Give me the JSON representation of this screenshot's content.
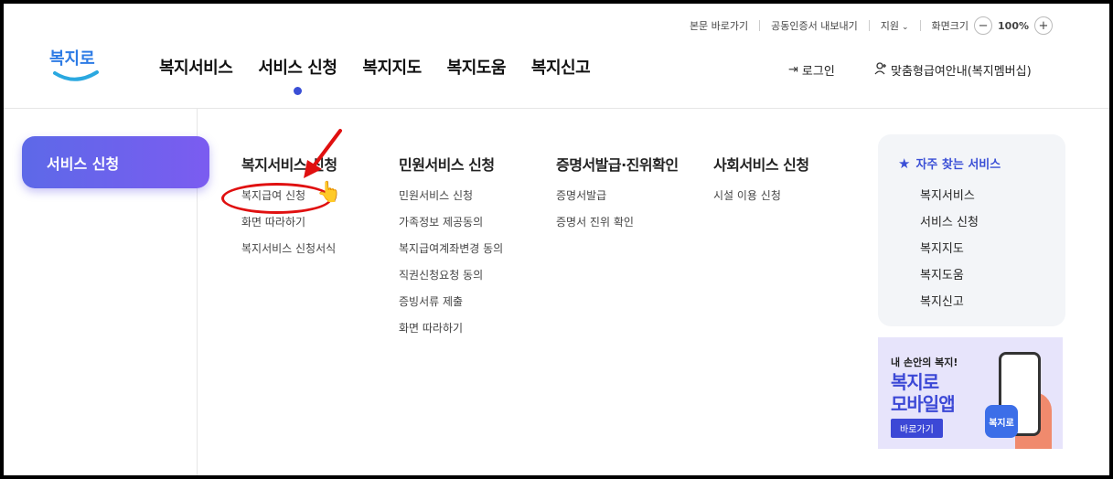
{
  "utility": {
    "skip": "본문 바로가기",
    "cert": "공동인증서 내보내기",
    "support": "지원",
    "screen_size": "화면크기",
    "zoom_minus": "−",
    "zoom_value": "100%",
    "zoom_plus": "+"
  },
  "header": {
    "logo_text": "복지로",
    "nav": [
      "복지서비스",
      "서비스 신청",
      "복지지도",
      "복지도움",
      "복지신고"
    ],
    "active_nav": "서비스 신청",
    "login": "로그인",
    "member": "맞춤형급여안내(복지멤버십)"
  },
  "left": {
    "title": "서비스 신청"
  },
  "menu": {
    "columns": [
      {
        "title": "복지서비스 신청",
        "items": [
          "복지급여 신청",
          "화면 따라하기",
          "복지서비스 신청서식"
        ]
      },
      {
        "title": "민원서비스 신청",
        "items": [
          "민원서비스 신청",
          "가족정보 제공동의",
          "복지급여계좌변경 동의",
          "직권신청요청 동의",
          "증빙서류 제출",
          "화면 따라하기"
        ]
      },
      {
        "title": "증명서발급·진위확인",
        "items": [
          "증명서발급",
          "증명서 진위 확인"
        ]
      },
      {
        "title": "사회서비스 신청",
        "items": [
          "시설 이용 신청"
        ]
      }
    ]
  },
  "favorites": {
    "title": "자주 찾는 서비스",
    "items": [
      "복지서비스",
      "서비스 신청",
      "복지지도",
      "복지도움",
      "복지신고"
    ]
  },
  "banner": {
    "small": "내 손안의 복지!",
    "big1": "복지로",
    "big2": "모바일앱",
    "button": "바로가기",
    "app_label": "복지로"
  },
  "colors": {
    "accent": "#3a4fd6",
    "pill_start": "#5d69e8",
    "pill_end": "#7b5cf0",
    "annotation": "#e01010"
  }
}
